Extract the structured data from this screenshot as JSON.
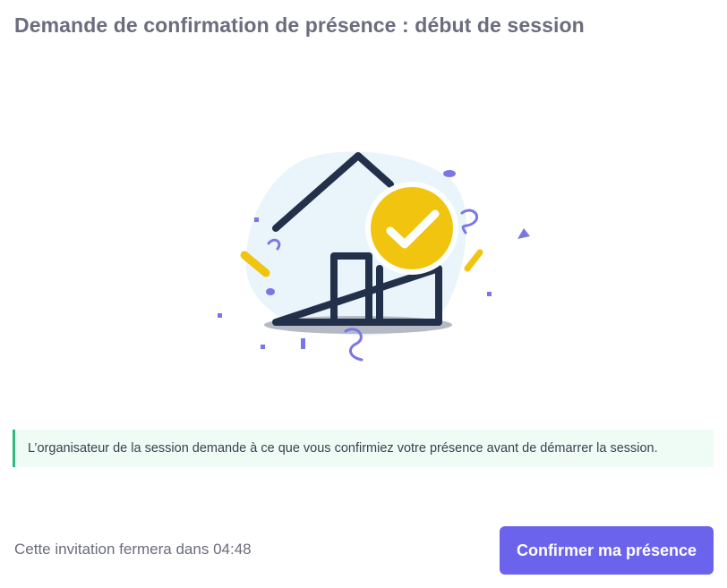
{
  "header": {
    "title": "Demande de confirmation de présence : début de session"
  },
  "illustration": {
    "icon": "house-check-icon",
    "colors": {
      "outline": "#23304a",
      "blob": "#e9f5fb",
      "check_circle": "#f1c40f",
      "confetti": "#7b76e8",
      "shadow": "#b4b9c4"
    }
  },
  "notice": {
    "text": "L’organisateur de la session demande à ce que vous confirmiez votre présence avant de démarrer la session.",
    "accent_color": "#2fb980",
    "background_color": "#eefcf5"
  },
  "footer": {
    "countdown_prefix": "Cette invitation fermera dans",
    "countdown_time": "04:48",
    "confirm_label": "Confirmer ma présence",
    "confirm_color": "#6b63ec"
  }
}
